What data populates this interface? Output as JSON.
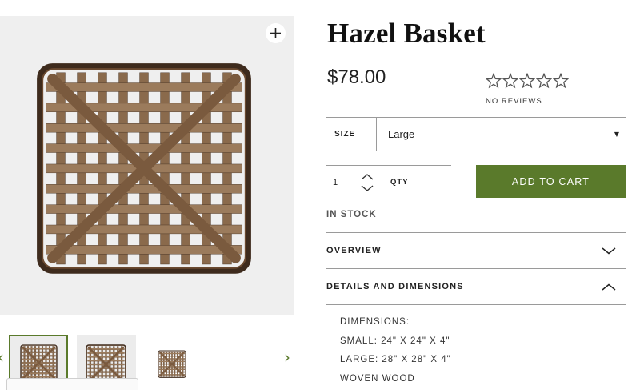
{
  "product": {
    "title": "Hazel Basket",
    "price": "$78.00",
    "rating_stars": 0,
    "rating_max": 5,
    "reviews_label": "NO REVIEWS",
    "stock_status": "IN STOCK"
  },
  "gallery": {
    "zoom_icon": "plus-icon",
    "prev_icon": "chevron-left-icon",
    "next_icon": "chevron-right-icon",
    "prev_glyph": "‹",
    "next_glyph": "›",
    "thumbnails": [
      {
        "name": "thumbnail-1",
        "selected": true
      },
      {
        "name": "thumbnail-2",
        "selected": false
      },
      {
        "name": "thumbnail-3",
        "selected": false
      }
    ]
  },
  "options": {
    "size_label": "SIZE",
    "size_value": "Large",
    "size_caret_glyph": "▼"
  },
  "purchase": {
    "qty_value": "1",
    "qty_label": "QTY",
    "add_to_cart_label": "ADD TO CART"
  },
  "accordions": {
    "overview": {
      "label": "OVERVIEW",
      "expanded": false
    },
    "details": {
      "label": "DETAILS AND DIMENSIONS",
      "expanded": true
    }
  },
  "details_lines": [
    "DIMENSIONS:",
    "SMALL: 24\" X 24\" X 4\"",
    "LARGE: 28\" X 28\" X 4\"",
    "WOVEN WOOD"
  ],
  "colors": {
    "accent_green": "#5a7a2b",
    "basket_wood": "#8a6a4c",
    "basket_dark": "#3e2b1d"
  }
}
